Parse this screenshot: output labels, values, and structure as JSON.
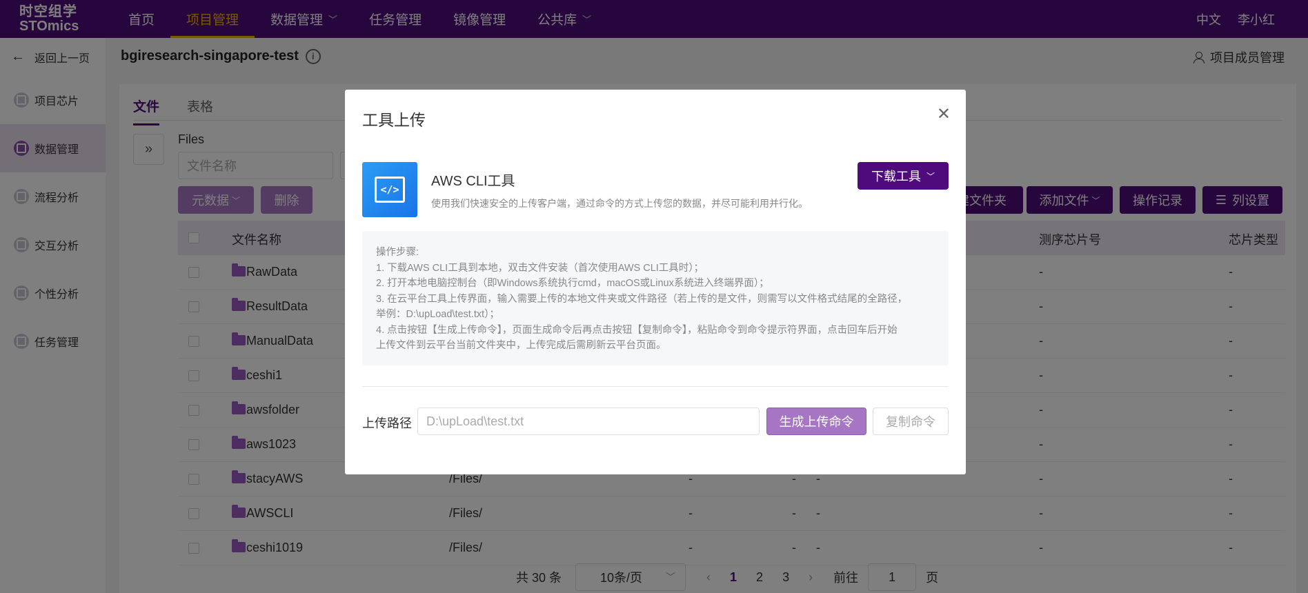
{
  "topnav": {
    "logo_line1": "时空组学",
    "logo_line2": "STOmics",
    "items": [
      {
        "label": "首页"
      },
      {
        "label": "项目管理"
      },
      {
        "label": "数据管理"
      },
      {
        "label": "任务管理"
      },
      {
        "label": "镜像管理"
      },
      {
        "label": "公共库"
      }
    ],
    "lang": "中文",
    "user": "李小红"
  },
  "sidebar": {
    "back": "返回上一页",
    "items": [
      {
        "label": "项目芯片"
      },
      {
        "label": "数据管理"
      },
      {
        "label": "流程分析"
      },
      {
        "label": "交互分析"
      },
      {
        "label": "个性分析"
      },
      {
        "label": "任务管理"
      }
    ]
  },
  "project": {
    "title": "bgiresearch-singapore-test",
    "members": "项目成员管理"
  },
  "main": {
    "tabs": [
      "文件",
      "表格"
    ],
    "files_label": "Files",
    "search_placeholder": "文件名称",
    "buttons": {
      "metadata": "元数据",
      "delete": "删除",
      "folder": "建文件夹",
      "add_file": "添加文件",
      "history": "操作记录",
      "columns": "列设置"
    },
    "columns": {
      "name": "文件名称",
      "chip_no": "测序芯片号",
      "chip_type": "芯片类型"
    },
    "rows": [
      {
        "name": "RawData",
        "path": "",
        "chip": "-",
        "type": "-"
      },
      {
        "name": "ResultData",
        "path": "",
        "chip": "-",
        "type": "-"
      },
      {
        "name": "ManualData",
        "path": "",
        "chip": "-",
        "type": "-"
      },
      {
        "name": "ceshi1",
        "path": "",
        "chip": "-",
        "type": "-"
      },
      {
        "name": "awsfolder",
        "path": "",
        "chip": "-",
        "type": "-"
      },
      {
        "name": "aws1023",
        "path": "",
        "chip": "-",
        "type": "-"
      },
      {
        "name": "stacyAWS",
        "path": "/Files/",
        "c1": "-",
        "c2": "-",
        "c3": "-",
        "chip": "-",
        "type": "-"
      },
      {
        "name": "AWSCLI",
        "path": "/Files/",
        "c1": "-",
        "c2": "-",
        "c3": "-",
        "chip": "-",
        "type": "-"
      },
      {
        "name": "ceshi1019",
        "path": "/Files/",
        "c1": "-",
        "c2": "-",
        "c3": "-",
        "chip": "-",
        "type": "-"
      }
    ],
    "pager": {
      "total": "共 30 条",
      "size": "10条/页",
      "pages": [
        "1",
        "2",
        "3"
      ],
      "goto": "前往",
      "goto_value": "1",
      "page_suffix": "页"
    }
  },
  "modal": {
    "title": "工具上传",
    "tool_name": "AWS CLI工具",
    "tool_desc": "使用我们快速安全的上传客户端，通过命令的方式上传您的数据，并尽可能利用并行化。",
    "download_btn": "下载工具",
    "steps_title": "操作步骤:",
    "steps": [
      "1. 下载AWS CLI工具到本地，双击文件安装（首次使用AWS CLI工具时）；",
      "2. 打开本地电脑控制台（即Windows系统执行cmd，macOS或Linux系统进入终端界面）；",
      "3. 在云平台工具上传界面，输入需要上传的本地文件夹或文件路径（若上传的是文件，则需写以文件格式结尾的全路径，",
      "举例：D:\\upLoad\\test.txt）；",
      "4. 点击按钮【生成上传命令】，页面生成命令后再点击按钮【复制命令】，粘贴命令到命令提示符界面，点击回车后开始",
      "上传文件到云平台当前文件夹中，上传完成后需刷新云平台页面。"
    ],
    "path_label": "上传路径",
    "path_placeholder": "D:\\upLoad\\test.txt",
    "gen_btn": "生成上传命令",
    "copy_btn": "复制命令"
  }
}
